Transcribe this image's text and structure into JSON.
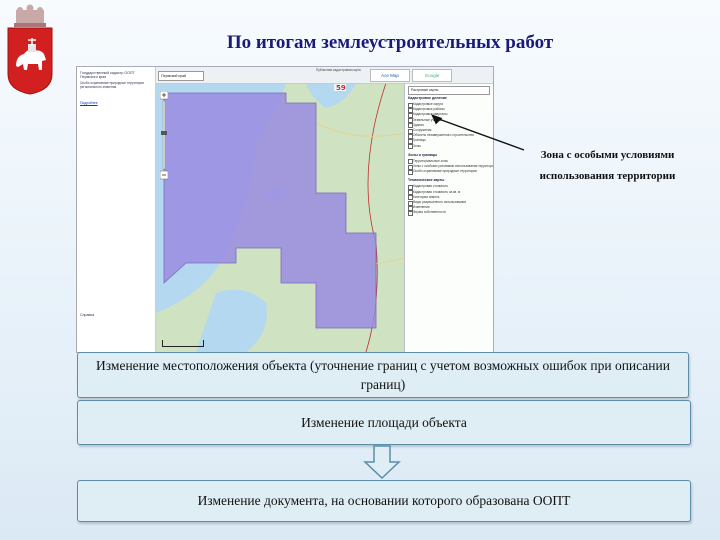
{
  "slide": {
    "title": "По итогам землеустроительных работ"
  },
  "callout": {
    "line1": "Зона с особыми условиями",
    "line2": "использования территории"
  },
  "flow": {
    "step1": "Изменение местоположения объекта (уточнение границ с учетом возможных ошибок при описании границ)",
    "step2": "Изменение площади объекта",
    "step3": "Изменение документа, на основании которого образована ООПТ"
  },
  "app": {
    "left_panel": {
      "title": "Государственный кадастр ООПТ Пермского края",
      "info": "Особо охраняемые природные территории регионального значения",
      "link": "Подробнее",
      "footer": "Справка"
    },
    "toolbar": {
      "region_select": "Пермский край",
      "portal_note": "Публичная кадастровая карта",
      "ace_button": "Ace Map",
      "google_button": "Google"
    },
    "map_labels": {
      "parcel_number": "59"
    },
    "layer_panel": {
      "select_value": "Растровые карты",
      "sections": [
        {
          "heading": "Кадастровое деление",
          "items": [
            "Кадастровые округа",
            "Кадастровые районы",
            "Кадастровые кварталы",
            "Земельные участки",
            "Здания",
            "Сооружения",
            "Объекты незавершенного строительства",
            "Границы",
            "Зоны"
          ]
        },
        {
          "heading": "Зоны и границы",
          "items": [
            "Территориальные зоны",
            "Зоны с особыми условиями использования территории",
            "Особо охраняемые природные территории"
          ]
        },
        {
          "heading": "Тематические карты",
          "items": [
            "Кадастровая стоимость",
            "Кадастровая стоимость за кв. м",
            "Категории земель",
            "Виды разрешенного использования",
            "Изменения",
            "Форма собственности"
          ]
        }
      ]
    }
  },
  "colors": {
    "title": "#1a1a7a",
    "box_fill": "#dfeef5",
    "box_border": "#5b8ea8",
    "zone_fill": "#9a8ce0",
    "water": "#b4d8f0",
    "forest": "#cfe2c2"
  },
  "icons": [
    "coat-of-arms-icon",
    "zoom-in-icon",
    "zoom-out-icon",
    "down-arrow-icon",
    "pointer-arrow-icon"
  ]
}
